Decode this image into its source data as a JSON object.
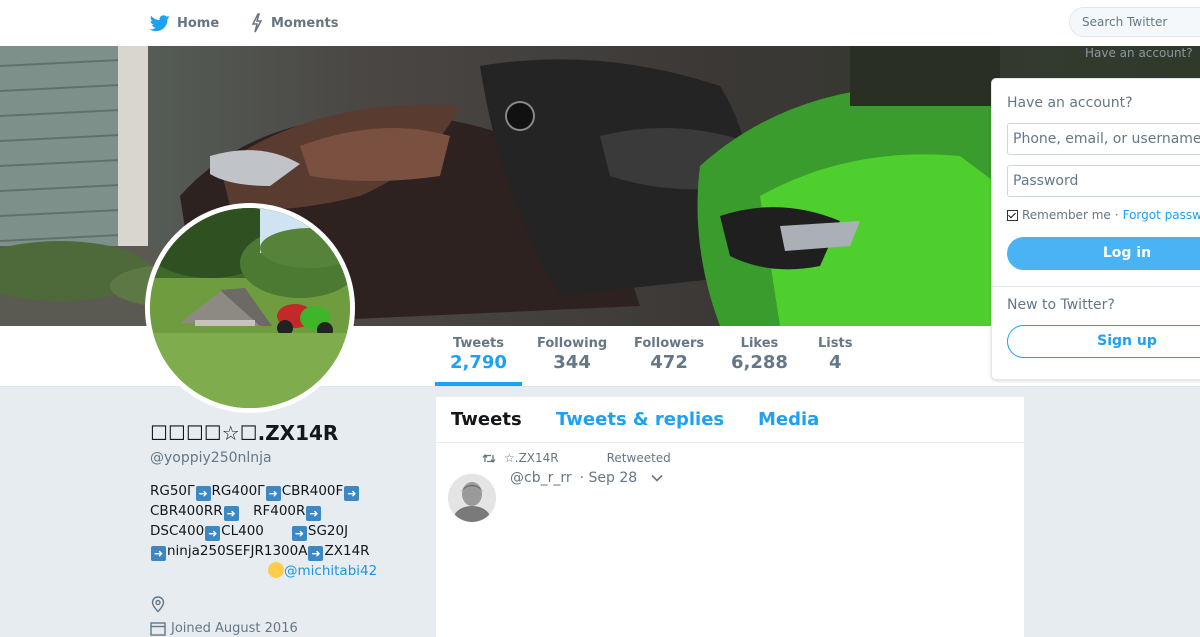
{
  "nav": {
    "home_label": "Home",
    "moments_label": "Moments",
    "search_placeholder": "Search Twitter",
    "have_account_link": "Have an account?"
  },
  "profile": {
    "name": "☐☐☐☐☆☐.ZX14R",
    "handle": "@yoppiy250nlnja",
    "bio_lines": [
      [
        "RG50Γ",
        "RG400Γ",
        "CBR400F",
        ""
      ],
      [
        "CBR400RR",
        "　RF400R",
        ""
      ],
      [
        "DSC400",
        "CL400　　",
        "SG20J"
      ],
      [
        "",
        "ninja250SEFJR1300A",
        "ZX14R"
      ]
    ],
    "bio_mention": "@michitabi42",
    "joined": "Joined August 2016"
  },
  "stats": [
    {
      "label": "Tweets",
      "value": "2,790"
    },
    {
      "label": "Following",
      "value": "344"
    },
    {
      "label": "Followers",
      "value": "472"
    },
    {
      "label": "Likes",
      "value": "6,288"
    },
    {
      "label": "Lists",
      "value": "4"
    }
  ],
  "timeline": {
    "tabs": [
      "Tweets",
      "Tweets & replies",
      "Media"
    ],
    "tweet": {
      "retweeted_by": "☆.ZX14R",
      "retweeted_label": "Retweeted",
      "author_handle": "@cb_r_rr",
      "time": "· Sep 28"
    }
  },
  "login": {
    "title": "Have an account?",
    "phone_placeholder": "Phone, email, or username",
    "password_placeholder": "Password",
    "remember_label": "Remember me",
    "separator": "·",
    "forgot_label": "Forgot password?",
    "login_label": "Log in",
    "new_title": "New to Twitter?",
    "signup_label": "Sign up"
  },
  "colors": {
    "accent": "#1da1f2",
    "background": "#e6ecf0"
  },
  "icons": [
    "twitter-bird-icon",
    "lightning-icon",
    "location-pin-icon",
    "calendar-icon",
    "retweet-icon",
    "chevron-down-icon",
    "arrow-right-emoji-icon",
    "sweat-smile-emoji-icon"
  ]
}
